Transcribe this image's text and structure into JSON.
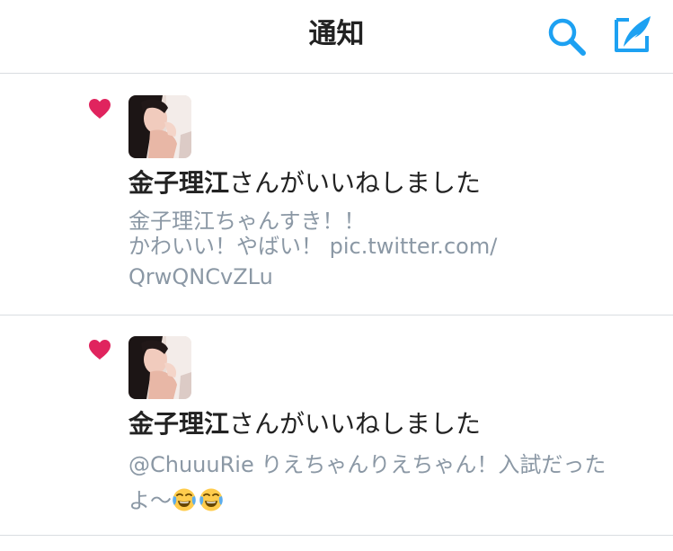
{
  "header": {
    "title": "通知"
  },
  "notifications": [
    {
      "user_name": "金子理江",
      "action_text": "さんがいいねしました",
      "tweet_lines": [
        "金子理江ちゃんすき！！",
        "かわいい！やばい！ pic.twitter.com/",
        "QrwQNCvZLu"
      ],
      "emojis": []
    },
    {
      "user_name": "金子理江",
      "action_text": "さんがいいねしました",
      "tweet_lines": [
        "@ChuuuRie りえちゃんりえちゃん！入試だった",
        "よ〜"
      ],
      "emojis": [
        "face-with-tears-of-joy",
        "face-with-tears-of-joy"
      ]
    }
  ],
  "colors": {
    "accent": "#1da1f2",
    "like": "#e0245e",
    "text": "#222222",
    "secondary_text": "#8b98a5",
    "divider": "#d9dde1"
  },
  "icons": {
    "search": "search-icon",
    "compose": "compose-tweet-icon",
    "like": "heart-icon",
    "emoji": "face-with-tears-of-joy-icon"
  }
}
